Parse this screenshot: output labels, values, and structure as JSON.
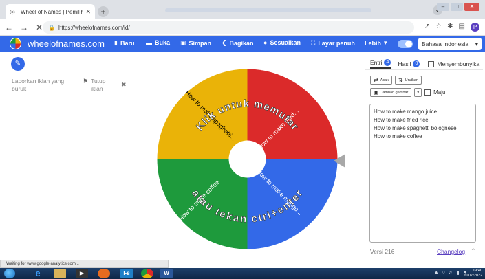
{
  "browser": {
    "tab_title": "Wheel of Names | Pemilih nama",
    "new_tab_icon": "plus-icon",
    "url": "https://wheelofnames.com/id/",
    "profile_initial": "P"
  },
  "app": {
    "brand": "wheelofnames.com",
    "menu": [
      {
        "label": "Baru",
        "icon": "file-icon"
      },
      {
        "label": "Buka",
        "icon": "folder-icon"
      },
      {
        "label": "Simpan",
        "icon": "save-icon"
      },
      {
        "label": "Bagikan",
        "icon": "share-icon"
      },
      {
        "label": "Sesuaikan",
        "icon": "palette-icon"
      },
      {
        "label": "Layar penuh",
        "icon": "fullscreen-icon"
      },
      {
        "label": "Lebih",
        "icon": "chevron-down-icon"
      }
    ],
    "language": "Bahasa Indonesia"
  },
  "left": {
    "report_ad": "Laporkan iklan yang buruk",
    "close_ad": "Tutup iklan"
  },
  "wheel": {
    "center_text_top": "Klik untuk memutar",
    "center_text_bottom": "atau tekan ctrl+enter",
    "segments": [
      {
        "label": "How to make fried...",
        "color": "#db2a2a"
      },
      {
        "label": "How to make mango...",
        "color": "#3369e8"
      },
      {
        "label": "How to make coffee",
        "color": "#1e9a3c"
      },
      {
        "label": "How to make spaghetti...",
        "color": "#eab308"
      }
    ]
  },
  "panel": {
    "tab_entries": "Entri",
    "entries_count": "4",
    "tab_results": "Hasil",
    "results_count": "0",
    "hide_label": "Menyembunyika",
    "shuffle_label": "Acak",
    "sort_label": "Urutkan",
    "add_image_label": "Tambah gambar",
    "advanced_label": "Maju",
    "entries": [
      "How to make mango juice",
      "How to make fried rice",
      "How to make spaghetti bolognese",
      "How to make coffee"
    ],
    "version": "Versi 216",
    "changelog": "Changelog"
  },
  "status_text": "Waiting for www.google-analytics.com...",
  "taskbar": {
    "clock_time": "19:40",
    "clock_date": "20/07/2022"
  }
}
